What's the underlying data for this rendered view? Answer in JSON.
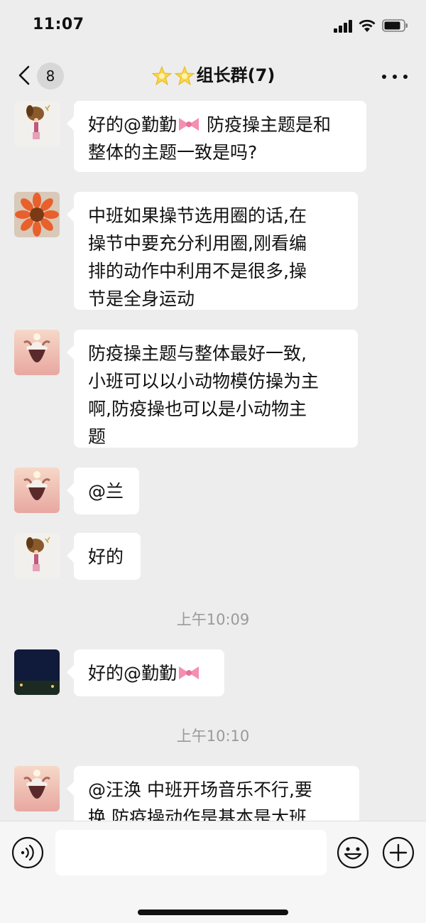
{
  "status_bar": {
    "time": "11:07"
  },
  "nav": {
    "unread_count": "8",
    "title": "组长群(7)",
    "title_icon": "star-emoji"
  },
  "messages": [
    {
      "avatar": "dog-drawing-avatar",
      "text": "好的@勤勤",
      "text_after": " 防疫操主题是和\n整体的主题一致是吗?",
      "emoji": "ribbon-emoji"
    },
    {
      "avatar": "sunflower-avatar",
      "text": "中班如果操节选用圈的话,在\n操节中要充分利用圈,刚看编\n排的动作中利用不是很多,操\n节是全身运动"
    },
    {
      "avatar": "sunset-girl-avatar",
      "text": "防疫操主题与整体最好一致,\n小班可以以小动物模仿操为主\n啊,防疫操也可以是小动物主\n题"
    },
    {
      "avatar": "sunset-girl-avatar",
      "text": "@兰"
    },
    {
      "avatar": "dog-drawing-avatar",
      "text": "好的"
    },
    {
      "avatar": "moon-night-avatar",
      "text": "好的@勤勤",
      "emoji": "ribbon-emoji"
    },
    {
      "avatar": "sunset-girl-avatar",
      "text": "@汪涣 中班开场音乐不行,要\n换,防疫操动作是基本是大班"
    }
  ],
  "timestamps": [
    "上午10:09",
    "上午10:10"
  ],
  "colors": {
    "background": "#ededed",
    "bubble": "#ffffff",
    "timestamp": "#9a9a9a",
    "input_bar": "#f6f6f6"
  },
  "input_bar": {
    "voice_icon": "voice-icon",
    "emoji_icon": "emoji-icon",
    "plus_icon": "plus-icon"
  }
}
